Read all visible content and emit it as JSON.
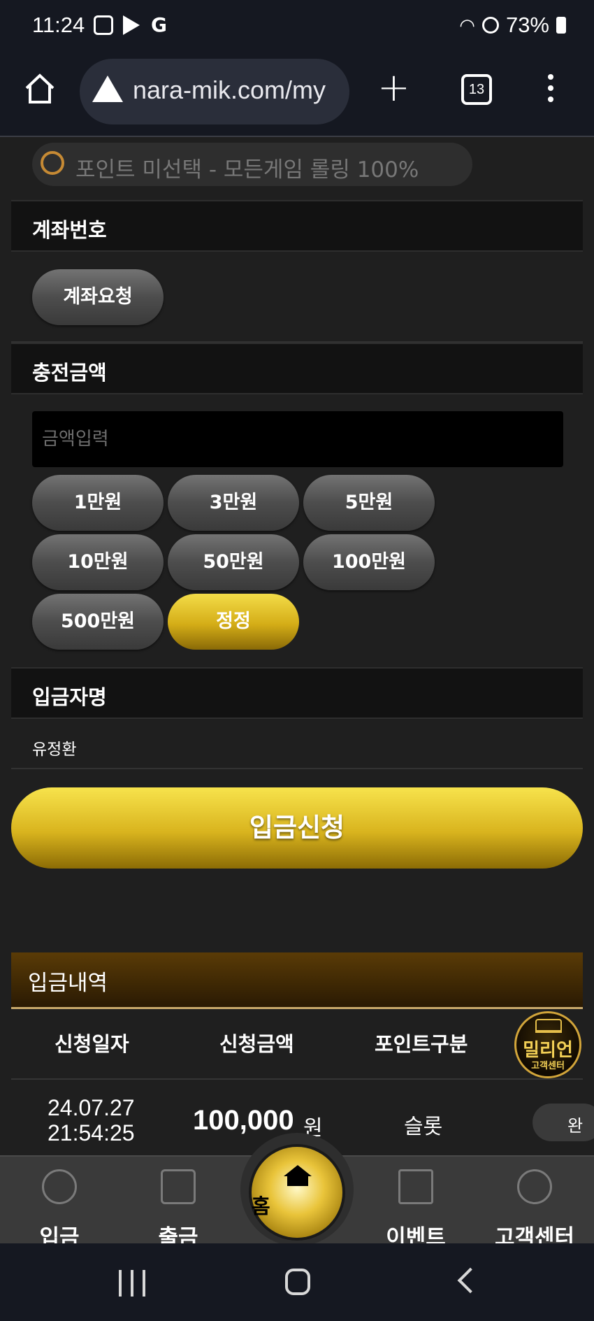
{
  "status_bar": {
    "time": "11:24",
    "battery": "73%"
  },
  "browser": {
    "url": "nara-mik.com/my",
    "tab_count": "13"
  },
  "point_option": {
    "label": "포인트 미선택 - 모든게임 롤링 100%"
  },
  "account": {
    "heading": "계좌번호",
    "request_button": "계좌요청"
  },
  "charge": {
    "heading": "충전금액",
    "input_placeholder": "금액입력",
    "amounts": [
      "1만원",
      "3만원",
      "5만원",
      "10만원",
      "50만원",
      "100만원",
      "500만원"
    ],
    "reset_label": "정정"
  },
  "depositor": {
    "heading": "입금자명",
    "name": "유정환"
  },
  "submit_label": "입금신청",
  "history": {
    "title": "입금내역",
    "columns": [
      "신청일자",
      "신청금액",
      "포인트구분"
    ],
    "rows": [
      {
        "date": "24.07.27",
        "time": "21:54:25",
        "amount": "100,000",
        "unit": "원",
        "point_type": "슬롯",
        "status": "완"
      }
    ]
  },
  "support_badge": {
    "line1": "밀리언",
    "line2": "고객센터"
  },
  "bottom_nav": {
    "deposit": "입금",
    "withdraw": "출금",
    "home": "홈",
    "event": "이벤트",
    "support": "고객센터"
  }
}
